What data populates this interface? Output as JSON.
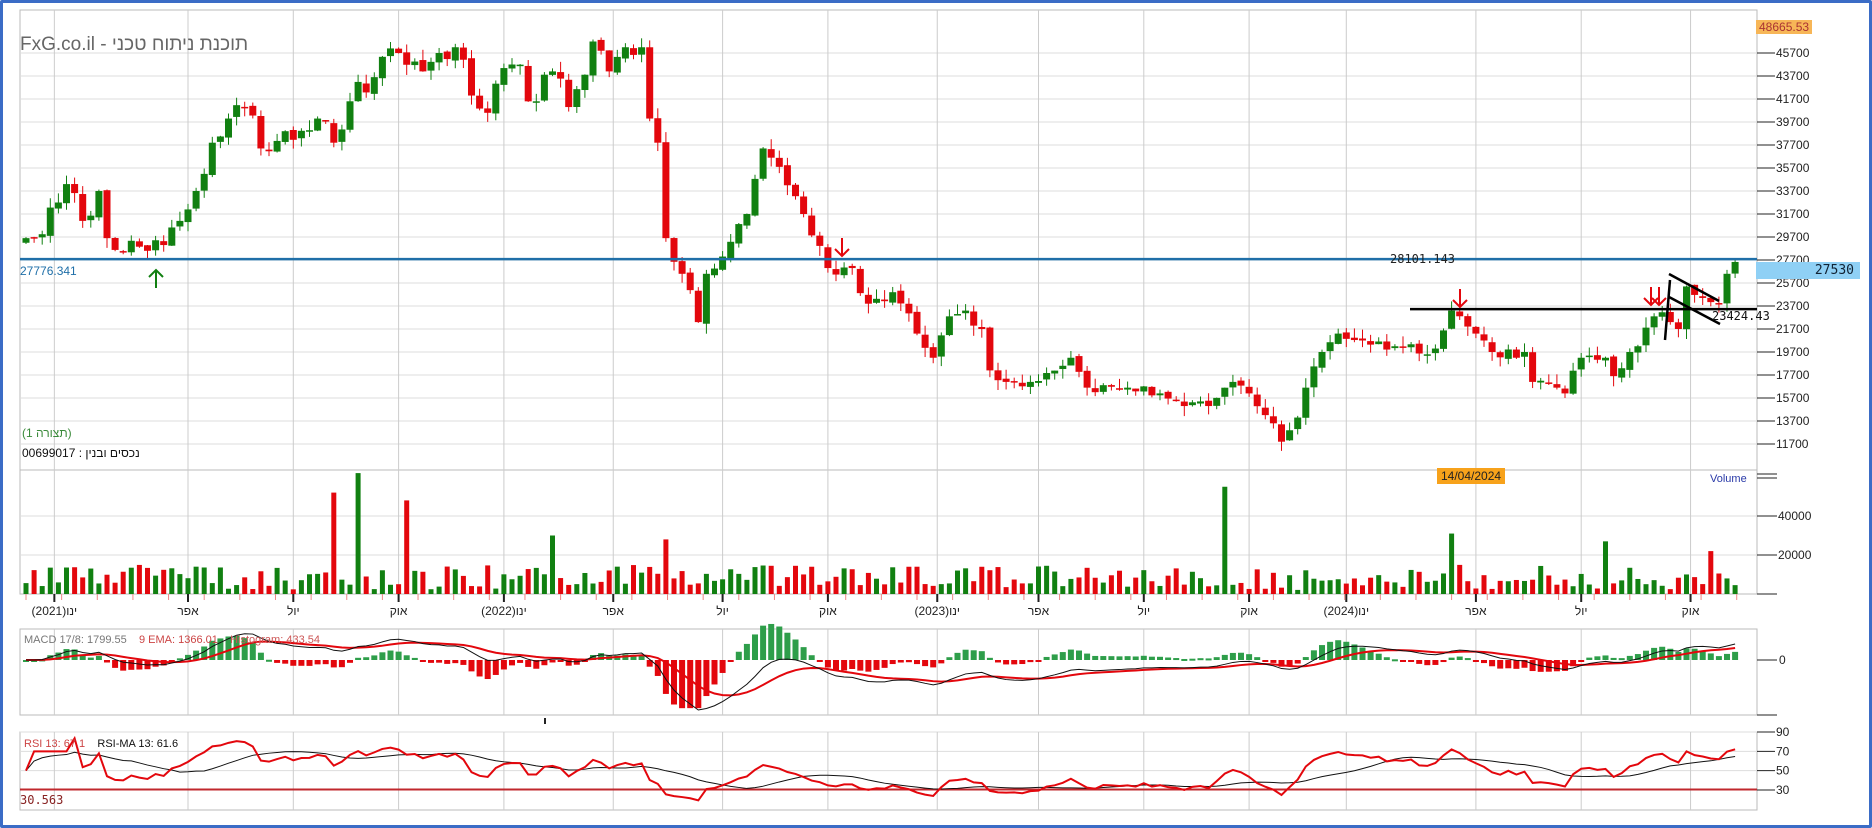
{
  "header": {
    "title": "FxG.co.il - תוכנת ניתוח טכני",
    "config_label": "(תצורה 1)",
    "asset_label": "נכסים ובנין : 00699017"
  },
  "price_panel": {
    "top_tag": "48665.53",
    "last_price": "27530",
    "hline_value": 27776.341,
    "hline_label": "27776.341",
    "hline2_label": "28101.143",
    "black_line_value": 23424.43,
    "black_line_label": "23424.43",
    "ticks": [
      45700,
      43700,
      41700,
      39700,
      37700,
      35700,
      33700,
      31700,
      29700,
      27700,
      25700,
      23700,
      21700,
      19700,
      17700,
      15700,
      13700,
      11700
    ]
  },
  "date_tag": "14/04/2024",
  "volume_panel": {
    "label": "Volume",
    "ticks": [
      40000,
      20000
    ]
  },
  "x_axis": {
    "months": [
      {
        "label": "ינו(2021)",
        "week": 3.5
      },
      {
        "label": "אפר",
        "week": 20
      },
      {
        "label": "יול",
        "week": 33
      },
      {
        "label": "אוק",
        "week": 46
      },
      {
        "label": "ינו(2022)",
        "week": 59
      },
      {
        "label": "אפר",
        "week": 72.5
      },
      {
        "label": "יול",
        "week": 86
      },
      {
        "label": "אוק",
        "week": 99
      },
      {
        "label": "ינו(2023)",
        "week": 112.5
      },
      {
        "label": "אפר",
        "week": 125
      },
      {
        "label": "יול",
        "week": 138
      },
      {
        "label": "אוק",
        "week": 151
      },
      {
        "label": "ינו(2024)",
        "week": 163
      },
      {
        "label": "אפר",
        "week": 179
      },
      {
        "label": "יול",
        "week": 192
      },
      {
        "label": "אוק",
        "week": 205.5
      }
    ]
  },
  "macd_panel": {
    "macd_label": "MACD 17/8: 1799.55",
    "ema_label": "9 EMA: 1366.01",
    "hist_label": "Histogram: 433.54",
    "zero_tick": "0"
  },
  "rsi_panel": {
    "rsi_label": "RSI 13: 67.1",
    "ma_label": "RSI-MA 13: 61.6",
    "low_label": "30.563",
    "ticks": [
      90,
      70,
      50,
      30
    ]
  },
  "colors": {
    "up": "#118011",
    "down": "#e3070d",
    "hline": "#1f6fa8",
    "frame": "#3b6cc6"
  },
  "chart_data": {
    "type": "candlestick",
    "interval": "weekly",
    "weeks": 212,
    "price_ylim": [
      10700,
      48665.53
    ],
    "close_anchors": [
      [
        0,
        29600
      ],
      [
        1,
        29600
      ],
      [
        4,
        32700
      ],
      [
        5,
        34300
      ],
      [
        7,
        31100
      ],
      [
        9,
        33700
      ],
      [
        10,
        29600
      ],
      [
        15,
        28500
      ],
      [
        17,
        29000
      ],
      [
        19,
        31100
      ],
      [
        21,
        33700
      ],
      [
        23,
        37900
      ],
      [
        25,
        40000
      ],
      [
        27,
        41000
      ],
      [
        29,
        37400
      ],
      [
        32,
        38900
      ],
      [
        36,
        40000
      ],
      [
        38,
        37900
      ],
      [
        40,
        41500
      ],
      [
        43,
        43600
      ],
      [
        46,
        45700
      ],
      [
        49,
        44100
      ],
      [
        51,
        45700
      ],
      [
        53,
        46200
      ],
      [
        55,
        42000
      ],
      [
        57,
        40500
      ],
      [
        60,
        44700
      ],
      [
        63,
        41500
      ],
      [
        65,
        44100
      ],
      [
        67,
        41000
      ],
      [
        70,
        46700
      ],
      [
        72,
        44100
      ],
      [
        74,
        46200
      ],
      [
        76,
        46200
      ],
      [
        77,
        40000
      ],
      [
        78,
        37900
      ],
      [
        79,
        29600
      ],
      [
        81,
        26500
      ],
      [
        83,
        22300
      ],
      [
        84,
        26500
      ],
      [
        86,
        28000
      ],
      [
        89,
        31700
      ],
      [
        91,
        37400
      ],
      [
        93,
        35800
      ],
      [
        96,
        31700
      ],
      [
        99,
        27000
      ],
      [
        102,
        27000
      ],
      [
        104,
        23900
      ],
      [
        107,
        24900
      ],
      [
        110,
        21300
      ],
      [
        112,
        19200
      ],
      [
        114,
        22800
      ],
      [
        116,
        23300
      ],
      [
        118,
        21700
      ],
      [
        119,
        18100
      ],
      [
        121,
        17100
      ],
      [
        124,
        17100
      ],
      [
        129,
        19200
      ],
      [
        131,
        16600
      ],
      [
        136,
        16600
      ],
      [
        140,
        16100
      ],
      [
        143,
        15000
      ],
      [
        146,
        15000
      ],
      [
        149,
        17100
      ],
      [
        151,
        16100
      ],
      [
        154,
        13500
      ],
      [
        155,
        11900
      ],
      [
        157,
        14000
      ],
      [
        158,
        16600
      ],
      [
        160,
        19700
      ],
      [
        162,
        21300
      ],
      [
        165,
        20700
      ],
      [
        169,
        20200
      ],
      [
        174,
        20000
      ],
      [
        176,
        23300
      ],
      [
        179,
        21300
      ],
      [
        181,
        19700
      ],
      [
        185,
        19700
      ],
      [
        186,
        17100
      ],
      [
        189,
        16600
      ],
      [
        190,
        16100
      ],
      [
        192,
        19200
      ],
      [
        195,
        19200
      ],
      [
        196,
        17600
      ],
      [
        198,
        19700
      ],
      [
        199,
        20200
      ],
      [
        201,
        22800
      ],
      [
        203,
        22300
      ],
      [
        204,
        21700
      ],
      [
        205,
        25400
      ],
      [
        207,
        24400
      ],
      [
        209,
        23900
      ],
      [
        210,
        26500
      ],
      [
        211,
        27530
      ]
    ],
    "volume_spikes": [
      [
        38,
        52000,
        "down"
      ],
      [
        41,
        62000,
        "up"
      ],
      [
        47,
        48000,
        "down"
      ],
      [
        65,
        30000,
        "up"
      ],
      [
        79,
        28000,
        "down"
      ],
      [
        148,
        55000,
        "up"
      ],
      [
        176,
        31000,
        "up"
      ],
      [
        195,
        27000,
        "down"
      ],
      [
        208,
        22000,
        "up"
      ]
    ],
    "volume_ylim": [
      0,
      60000
    ],
    "macd_params": [
      17,
      8,
      9
    ],
    "rsi_params": [
      13,
      13
    ],
    "rsi_ylim": [
      10,
      90
    ]
  }
}
